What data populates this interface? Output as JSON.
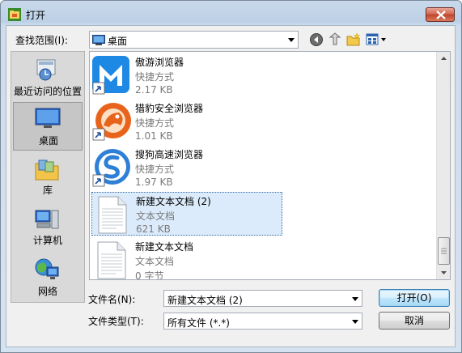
{
  "window": {
    "title": "打开"
  },
  "lookin": {
    "label": "查找范围(I):",
    "value": "桌面"
  },
  "places": [
    {
      "label": "最近访问的位置",
      "icon": "recent-places-icon"
    },
    {
      "label": "桌面",
      "icon": "desktop-icon",
      "selected": true
    },
    {
      "label": "库",
      "icon": "libraries-icon"
    },
    {
      "label": "计算机",
      "icon": "computer-icon"
    },
    {
      "label": "网络",
      "icon": "network-icon"
    }
  ],
  "files": [
    {
      "name": "傲游浏览器",
      "type": "快捷方式",
      "size": "2.17 KB",
      "icon": "maxthon-icon"
    },
    {
      "name": "猎豹安全浏览器",
      "type": "快捷方式",
      "size": "1.01 KB",
      "icon": "liebao-icon"
    },
    {
      "name": "搜狗高速浏览器",
      "type": "快捷方式",
      "size": "1.97 KB",
      "icon": "sogou-icon"
    },
    {
      "name": "新建文本文档 (2)",
      "type": "文本文档",
      "size": "621 KB",
      "icon": "text-document-icon",
      "selected": true
    },
    {
      "name": "新建文本文档",
      "type": "文本文档",
      "size": "0 字节",
      "icon": "text-document-icon"
    }
  ],
  "filename": {
    "label": "文件名(N):",
    "value": "新建文本文档 (2)"
  },
  "filetype": {
    "label": "文件类型(T):",
    "value": "所有文件 (*.*)"
  },
  "buttons": {
    "open": "打开(O)",
    "cancel": "取消"
  },
  "colors": {
    "accent": "#3c7fb1",
    "selection": "#dcebfb",
    "close": "#c0432a"
  }
}
